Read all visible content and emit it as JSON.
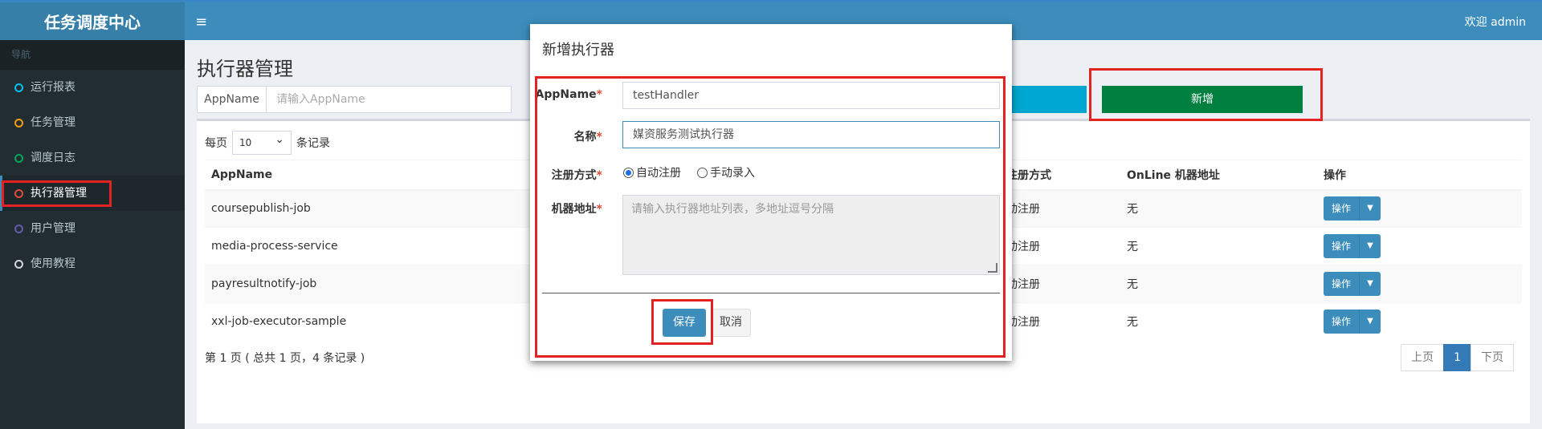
{
  "header": {
    "logo": "任务调度中心",
    "welcome": "欢迎 admin"
  },
  "sidebar": {
    "nav_header": "导航",
    "items": [
      {
        "label": "运行报表",
        "dot_color": "#00c0ef"
      },
      {
        "label": "任务管理",
        "dot_color": "#f39c12"
      },
      {
        "label": "调度日志",
        "dot_color": "#00a65a"
      },
      {
        "label": "执行器管理",
        "dot_color": "#dd4b39"
      },
      {
        "label": "用户管理",
        "dot_color": "#605ca8"
      },
      {
        "label": "使用教程",
        "dot_color": "#d2d6de"
      }
    ]
  },
  "main": {
    "page_title": "执行器管理",
    "filter_label": "AppName",
    "filter_placeholder": "请输入AppName",
    "add_button": "新增",
    "per_page_prefix": "每页",
    "per_page_value": "10",
    "per_page_suffix": "条记录",
    "columns": [
      "AppName",
      "注册方式",
      "OnLine 机器地址",
      "操作"
    ],
    "rows": [
      {
        "app": "coursepublish-job",
        "reg": "动注册",
        "addr": "无"
      },
      {
        "app": "media-process-service",
        "reg": "动注册",
        "addr": "无"
      },
      {
        "app": "payresultnotify-job",
        "reg": "动注册",
        "addr": "无"
      },
      {
        "app": "xxl-job-executor-sample",
        "reg": "动注册",
        "addr": "无"
      }
    ],
    "op_label": "操作",
    "info": "第 1 页 ( 总共 1 页，4 条记录 )",
    "pager": {
      "prev": "上页",
      "current": "1",
      "next": "下页"
    }
  },
  "modal": {
    "title": "新增执行器",
    "appname_label": "AppName",
    "appname_value": "testHandler",
    "name_label": "名称",
    "name_value": "媒资服务测试执行器",
    "reg_label": "注册方式",
    "reg_auto": "自动注册",
    "reg_manual": "手动录入",
    "addr_label": "机器地址",
    "addr_placeholder": "请输入执行器地址列表，多地址逗号分隔",
    "required_mark": "*",
    "save": "保存",
    "cancel": "取消"
  }
}
